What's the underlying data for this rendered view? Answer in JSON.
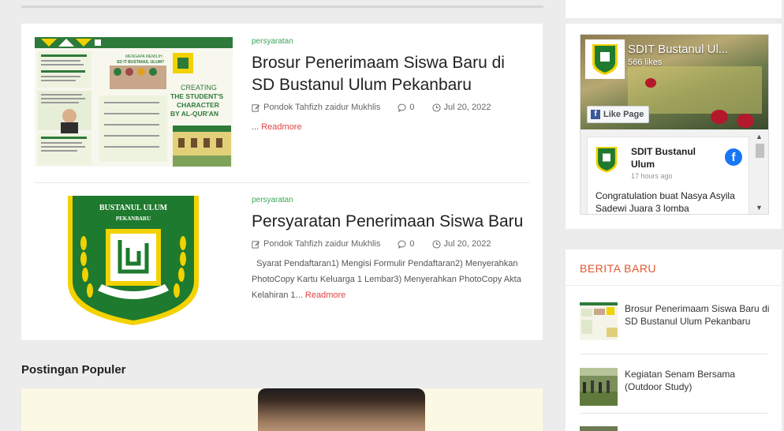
{
  "posts": [
    {
      "category": "persyaratan",
      "title": "Brosur Penerimaam Siswa Baru di SD Bustanul Ulum Pekanbaru",
      "author": "Pondok Tahfizh zaidur Mukhlis",
      "comments": "0",
      "date": "Jul 20, 2022",
      "excerpt": "...",
      "readmore": "Readmore",
      "brochure": {
        "headline_top": "MENGAPA MEMILIH",
        "headline_school": "SD IT BUSTANUL ULUM?",
        "tag1": "CREATING",
        "tag2": "THE STUDENT'S",
        "tag3": "CHARACTER",
        "tag4": "BY AL-QUR'AN"
      }
    },
    {
      "category": "persyaratan",
      "title": "Persyaratan Penerimaan Siswa Baru",
      "author": "Pondok Tahfizh zaidur Mukhlis",
      "comments": "0",
      "date": "Jul 20, 2022",
      "excerpt": "Syarat Pendaftaran1) Mengisi Formulir Pendaftaran2) Menyerahkan PhotoCopy Kartu Keluarga 1 Lembar3) Menyerahkan PhotoCopy Akta Kelahiran 1...",
      "readmore": "Readmore",
      "logo_text_top": "BUSTANUL ULUM",
      "logo_text_bottom": "PEKANBARU"
    }
  ],
  "popular": {
    "title": "Postingan Populer"
  },
  "facebook": {
    "page_name": "SDIT Bustanul Ul...",
    "likes": "566 likes",
    "like_button": "Like Page",
    "post_author": "SDIT Bustanul Ulum",
    "post_time": "17 hours ago",
    "post_text": "Congratulation buat Nasya Asyila Sadewi Juara 3 lomba"
  },
  "berita": {
    "title": "BERITA BARU",
    "items": [
      {
        "title": "Brosur Penerimaam Siswa Baru di SD Bustanul Ulum Pekanbaru"
      },
      {
        "title": "Kegiatan Senam Bersama (Outdoor Study)"
      }
    ]
  },
  "colors": {
    "category": "#3aa65a",
    "readmore": "#dd4444",
    "section_accent": "#e2572f",
    "logo_green": "#1e7a2e",
    "logo_yellow": "#f2d200"
  }
}
